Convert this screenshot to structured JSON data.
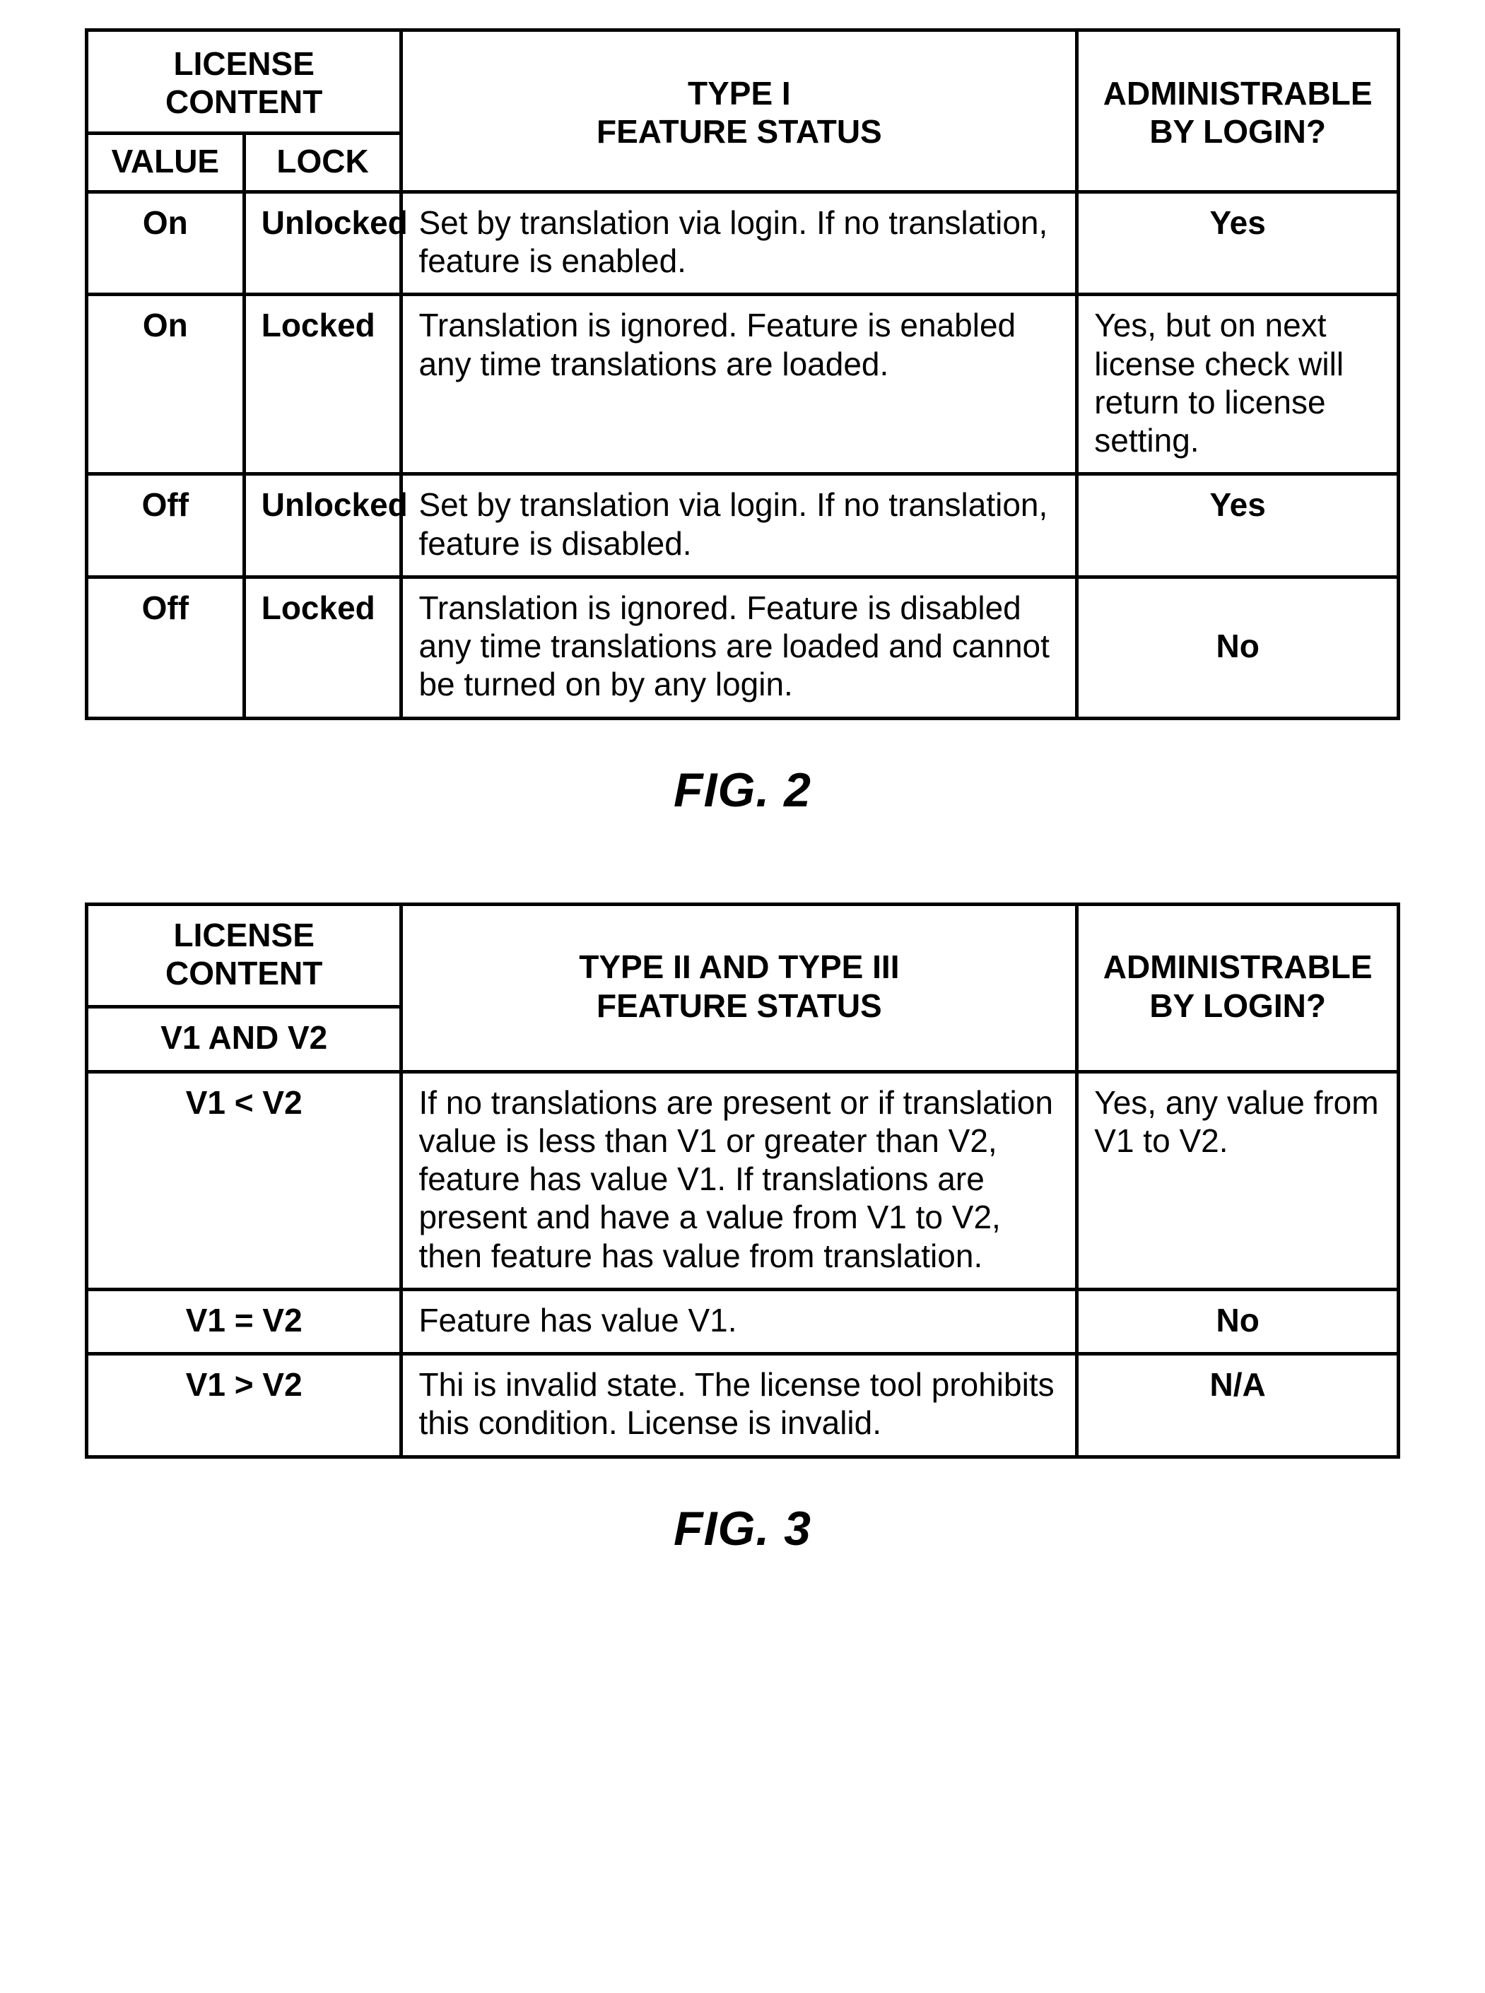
{
  "fig2": {
    "caption": "FIG. 2",
    "headers": {
      "licenseContent": "LICENSE CONTENT",
      "value": "VALUE",
      "lock": "LOCK",
      "type": "TYPE I\nFEATURE STATUS",
      "admin": "ADMINISTRABLE BY LOGIN?"
    },
    "rows": [
      {
        "value": "On",
        "lock": "Unlocked",
        "status": "Set by translation via login.  If no translation, feature is enabled.",
        "admin": "Yes"
      },
      {
        "value": "On",
        "lock": "Locked",
        "status": "Translation is ignored.  Feature is enabled any time translations are loaded.",
        "admin": "Yes, but on next license check will return to license setting."
      },
      {
        "value": "Off",
        "lock": "Unlocked",
        "status": "Set by translation via login.  If no translation, feature is disabled.",
        "admin": "Yes"
      },
      {
        "value": "Off",
        "lock": "Locked",
        "status": "Translation is ignored.  Feature is disabled any time translations are loaded and cannot be turned on by any login.",
        "admin": "No"
      }
    ]
  },
  "fig3": {
    "caption": "FIG. 3",
    "headers": {
      "licenseContent": "LICENSE CONTENT",
      "v1v2": "V1 AND V2",
      "type": "TYPE II AND TYPE III\nFEATURE STATUS",
      "admin": "ADMINISTRABLE BY LOGIN?"
    },
    "rows": [
      {
        "cond": "V1 < V2",
        "status": "If no translations are present or if translation value is less than V1 or greater than V2, feature has value V1.  If translations are present and have a value from V1 to V2, then feature has value from translation.",
        "admin": "Yes, any value from V1 to V2."
      },
      {
        "cond": "V1 = V2",
        "status": "Feature has value V1.",
        "admin": "No"
      },
      {
        "cond": "V1 > V2",
        "status": "Thi is invalid state.  The license tool prohibits this condition.  License is invalid.",
        "admin": "N/A"
      }
    ]
  }
}
